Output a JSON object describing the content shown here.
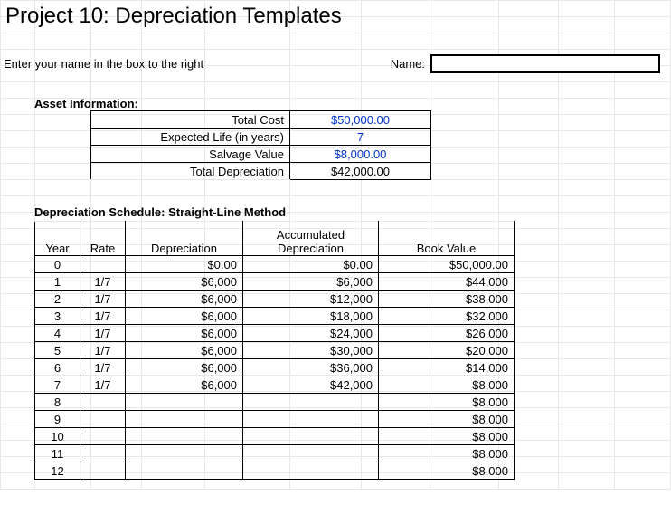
{
  "title": "Project 10: Depreciation Templates",
  "name_prompt": "Enter your name in the box to the right",
  "name_label": "Name:",
  "name_value": "",
  "asset_section": "Asset Information:",
  "asset": {
    "total_cost_label": "Total Cost",
    "total_cost": "$50,000.00",
    "life_label": "Expected  Life (in years)",
    "life": "7",
    "salvage_label": "Salvage Value",
    "salvage": "$8,000.00",
    "total_dep_label": "Total Depreciation",
    "total_dep": "$42,000.00"
  },
  "sched_section": "Depreciation Schedule: Straight-Line Method",
  "cols": {
    "year": "Year",
    "rate": "Rate",
    "dep": "Depreciation",
    "acc": "Accumulated Depreciation",
    "bv": "Book Value"
  },
  "rows": [
    {
      "year": "0",
      "rate": "",
      "dep": "$0.00",
      "acc": "$0.00",
      "bv": "$50,000.00"
    },
    {
      "year": "1",
      "rate": "1/7",
      "dep": "$6,000",
      "acc": "$6,000",
      "bv": "$44,000"
    },
    {
      "year": "2",
      "rate": "1/7",
      "dep": "$6,000",
      "acc": "$12,000",
      "bv": "$38,000"
    },
    {
      "year": "3",
      "rate": "1/7",
      "dep": "$6,000",
      "acc": "$18,000",
      "bv": "$32,000"
    },
    {
      "year": "4",
      "rate": "1/7",
      "dep": "$6,000",
      "acc": "$24,000",
      "bv": "$26,000"
    },
    {
      "year": "5",
      "rate": "1/7",
      "dep": "$6,000",
      "acc": "$30,000",
      "bv": "$20,000"
    },
    {
      "year": "6",
      "rate": "1/7",
      "dep": "$6,000",
      "acc": "$36,000",
      "bv": "$14,000"
    },
    {
      "year": "7",
      "rate": "1/7",
      "dep": "$6,000",
      "acc": "$42,000",
      "bv": "$8,000"
    },
    {
      "year": "8",
      "rate": "",
      "dep": "",
      "acc": "",
      "bv": "$8,000"
    },
    {
      "year": "9",
      "rate": "",
      "dep": "",
      "acc": "",
      "bv": "$8,000"
    },
    {
      "year": "10",
      "rate": "",
      "dep": "",
      "acc": "",
      "bv": "$8,000"
    },
    {
      "year": "11",
      "rate": "",
      "dep": "",
      "acc": "",
      "bv": "$8,000"
    },
    {
      "year": "12",
      "rate": "",
      "dep": "",
      "acc": "",
      "bv": "$8,000"
    }
  ]
}
